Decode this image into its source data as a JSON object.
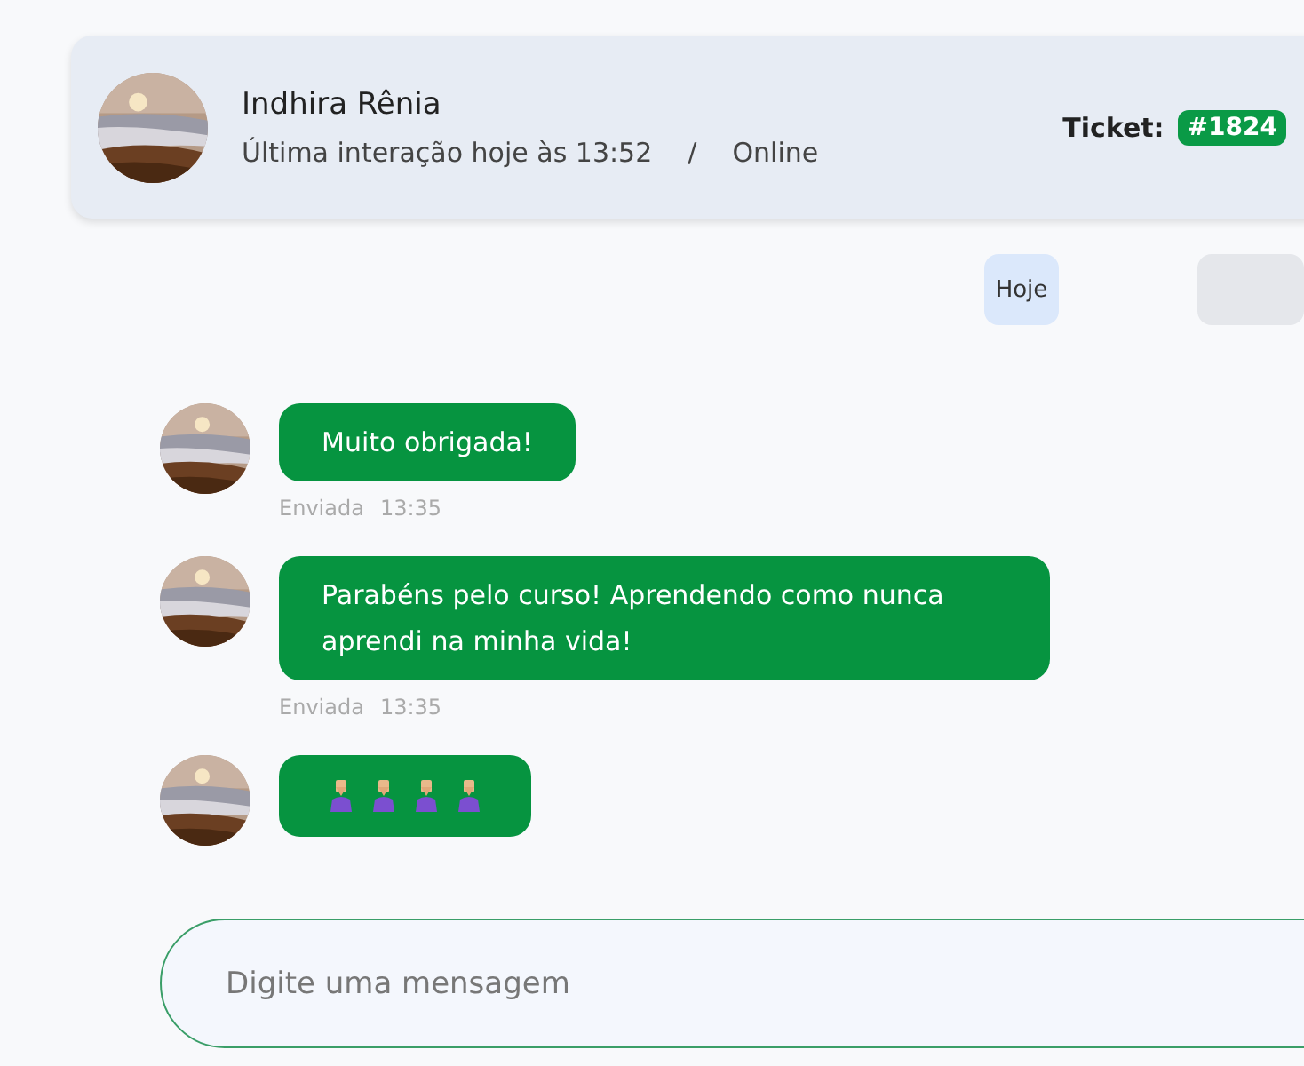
{
  "contact": {
    "name": "Indhira Rênia",
    "last_interaction": "Última interação hoje às 13:52",
    "separator": "/",
    "status": "Online",
    "ticket_label": "Ticket:",
    "ticket_number": "#1824"
  },
  "date_chips": [
    {
      "label": "Hoje",
      "kind": "date"
    },
    {
      "kind": "blank"
    }
  ],
  "messages": [
    {
      "kind": "text",
      "text": "Muito obrigada!",
      "status": "Enviada",
      "time": "13:35"
    },
    {
      "kind": "text",
      "text": "Parabéns pelo curso! Aprendendo como nunca aprendi na minha vida!",
      "status": "Enviada",
      "time": "13:35"
    },
    {
      "kind": "icons",
      "icons": [
        {
          "kind": "bowing"
        },
        {
          "kind": "bowing"
        },
        {
          "kind": "bowing"
        },
        {
          "kind": "bowing"
        }
      ]
    }
  ],
  "composer": {
    "placeholder": "Digite uma mensagem"
  }
}
